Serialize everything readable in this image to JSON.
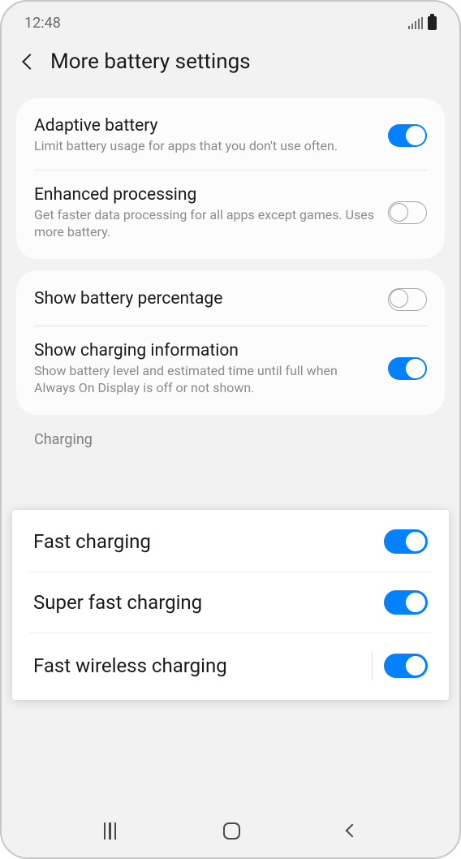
{
  "status": {
    "time": "12:48"
  },
  "header": {
    "title": "More battery settings"
  },
  "group1": {
    "adaptive": {
      "title": "Adaptive battery",
      "desc": "Limit battery usage for apps that you don't use often.",
      "on": true
    },
    "enhanced": {
      "title": "Enhanced processing",
      "desc": "Get faster data processing for all apps except games. Uses more battery.",
      "on": false
    }
  },
  "group2": {
    "percentage": {
      "title": "Show battery percentage",
      "on": false
    },
    "charging_info": {
      "title": "Show charging information",
      "desc": "Show battery level and estimated time until full when Always On Display is off or not shown.",
      "on": true
    }
  },
  "section_label": "Charging",
  "overlay": {
    "fast": {
      "title": "Fast charging",
      "on": true
    },
    "super": {
      "title": "Super fast charging",
      "on": true
    },
    "wireless": {
      "title": "Fast wireless charging",
      "on": true
    }
  }
}
